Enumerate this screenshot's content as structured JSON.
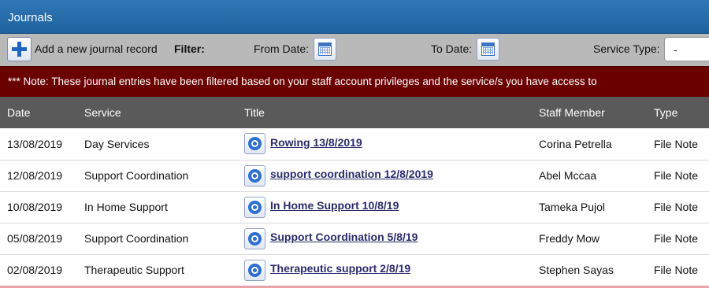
{
  "header": {
    "title": "Journals"
  },
  "toolbar": {
    "add_label": "Add a new journal record",
    "filter_label": "Filter:",
    "from_date_label": "From Date:",
    "to_date_label": "To Date:",
    "service_type_label": "Service Type:",
    "service_type_value": "-"
  },
  "notice": {
    "text": "*** Note: These journal entries have been filtered based on your staff account privileges and the service/s you have access to"
  },
  "table": {
    "columns": [
      "Date",
      "Service",
      "Title",
      "Staff Member",
      "Type"
    ],
    "rows": [
      {
        "date": "13/08/2019",
        "service": "Day Services",
        "title": "Rowing 13/8/2019",
        "staff": "Corina Petrella",
        "type": "File Note"
      },
      {
        "date": "12/08/2019",
        "service": "Support Coordination",
        "title": "support coordination 12/8/2019",
        "staff": "Abel Mccaa",
        "type": "File Note"
      },
      {
        "date": "10/08/2019",
        "service": "In Home Support",
        "title": "In Home Support 10/8/19",
        "staff": "Tameka Pujol",
        "type": "File Note"
      },
      {
        "date": "05/08/2019",
        "service": "Support Coordination",
        "title": "Support Coordination 5/8/19",
        "staff": "Freddy Mow",
        "type": "File Note"
      },
      {
        "date": "02/08/2019",
        "service": "Therapeutic Support",
        "title": "Therapeutic support 2/8/19",
        "staff": "Stephen Sayas",
        "type": "File Note"
      }
    ]
  },
  "colors": {
    "title_bar": "#2a70ae",
    "toolbar": "#b9b9b9",
    "notice": "#6b0000",
    "table_header": "#5a5a5a",
    "link": "#2b2b6b"
  },
  "icons": {
    "add": "plus-icon",
    "date_picker": "calendar-icon",
    "journal": "target-icon"
  }
}
